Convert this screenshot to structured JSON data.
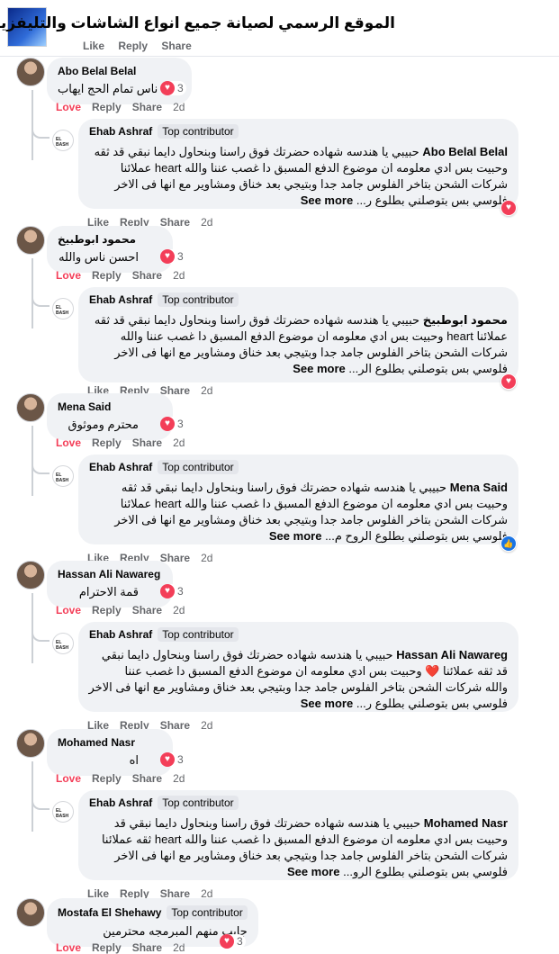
{
  "header": {
    "title": "الموقع الرسمي لصيانة جميع انواع الشاشات والتليفزيون بمصر",
    "actions": [
      "Like",
      "Reply",
      "Share"
    ]
  },
  "labels": {
    "love": "Love",
    "like": "Like",
    "reply": "Reply",
    "share": "Share",
    "see_more": "See more",
    "top_contributor": "Top contributor"
  },
  "colors": {
    "love": "#f33e58",
    "like": "#1b74e4",
    "bubble": "#f0f2f5",
    "meta": "#65676b"
  },
  "threads": [
    {
      "comment": {
        "author": "Abo Belal Belal",
        "text": "ناس تمام الحج ايهاب",
        "reactions": "3",
        "time": "2d",
        "reaction_icon": "heart-icon"
      },
      "reply": {
        "author": "Ehab Ashraf",
        "badge": "Top contributor",
        "lines": [
          "حبيبي يا هندسه شهاده حضرتك فوق راسنا وبنحاول دايما نبقي قد ثقه",
          "وحبيت بس ادي معلومه ان موضوع الدفع المسبق دا غصب عننا والله heart عملائنا",
          "شركات الشحن بتاخر الفلوس جامد جدا وبتيجي بعد خناق ومشاوير مع انها فى الاخر",
          "فلوسي بس بتوصلني بطلوع ر..."
        ],
        "mention": "Abo Belal Belal",
        "time": "2d",
        "reaction_icon": "heart-icon"
      }
    },
    {
      "comment": {
        "author": "محمود ابوطبيخ",
        "text": "احسن ناس والله",
        "reactions": "3",
        "time": "2d",
        "reaction_icon": "heart-icon"
      },
      "reply": {
        "author": "Ehab Ashraf",
        "badge": "Top contributor",
        "lines": [
          "حبيبي يا هندسه شهاده حضرتك فوق راسنا وبنحاول دايما نبقي قد ثقه",
          "عملائنا heart وحبيت بس ادي معلومه ان موضوع الدفع المسبق دا غصب عننا والله",
          "شركات الشحن بتاخر الفلوس جامد جدا وبتيجي بعد خناق ومشاوير مع انها فى الاخر",
          "فلوسي بس بتوصلني بطلوع الر..."
        ],
        "mention": "محمود ابوطبيخ",
        "time": "2d",
        "reaction_icon": "heart-icon"
      }
    },
    {
      "comment": {
        "author": "Mena Said",
        "text": "محترم وموثوق",
        "reactions": "3",
        "time": "2d",
        "reaction_icon": "heart-icon"
      },
      "reply": {
        "author": "Ehab Ashraf",
        "badge": "Top contributor",
        "lines": [
          "حبيبي يا هندسه شهاده حضرتك فوق راسنا وبنحاول دايما نبقي قد ثقه",
          "وحبيت بس ادي معلومه ان موضوع الدفع المسبق دا غصب عننا والله heart عملائنا",
          "شركات الشحن بتاخر الفلوس جامد جدا وبتيجي بعد خناق ومشاوير مع انها فى الاخر",
          "فلوسي بس بتوصلني بطلوع الروح م..."
        ],
        "mention": "Mena Said",
        "time": "2d",
        "reaction_icon": "like-icon"
      }
    },
    {
      "comment": {
        "author": "Hassan Ali Nawareg",
        "text": "قمة الاحترام",
        "reactions": "3",
        "time": "2d",
        "reaction_icon": "heart-icon"
      },
      "reply": {
        "author": "Ehab Ashraf",
        "badge": "Top contributor",
        "lines": [
          "حبيبي يا هندسه شهاده حضرتك فوق راسنا وبنحاول دايما نبقي",
          "قد ثقه عملائنا ❤️ وحبيت بس ادي معلومه ان موضوع الدفع المسبق دا غصب عننا",
          "والله شركات الشحن بتاخر الفلوس جامد جدا وبتيجي بعد خناق ومشاوير مع انها فى الاخر",
          "فلوسي بس بتوصلني بطلوع ر..."
        ],
        "mention": "Hassan Ali Nawareg",
        "time": "2d",
        "reaction_icon": "none"
      }
    },
    {
      "comment": {
        "author": "Mohamed Nasr",
        "text": "اه",
        "reactions": "3",
        "time": "2d",
        "reaction_icon": "heart-icon"
      },
      "reply": {
        "author": "Ehab Ashraf",
        "badge": "Top contributor",
        "lines": [
          "حبيبي يا هندسه شهاده حضرتك فوق راسنا وبنحاول دايما نبقي قد",
          "وحبيت بس ادي معلومه ان موضوع الدفع المسبق دا غصب عننا والله heart ثقه عملائنا",
          "شركات الشحن بتاخر الفلوس جامد جدا وبتيجي بعد خناق ومشاوير مع انها فى الاخر",
          "فلوسي بس بتوصلني بطلوع الرو..."
        ],
        "mention": "Mohamed Nasr",
        "time": "2d",
        "reaction_icon": "none"
      }
    }
  ],
  "last_comment": {
    "author": "Mostafa El Shehawy",
    "badge": "Top contributor",
    "text": "جايب منهم المبرمجه محترمين",
    "reactions": "3",
    "time": "2d"
  }
}
